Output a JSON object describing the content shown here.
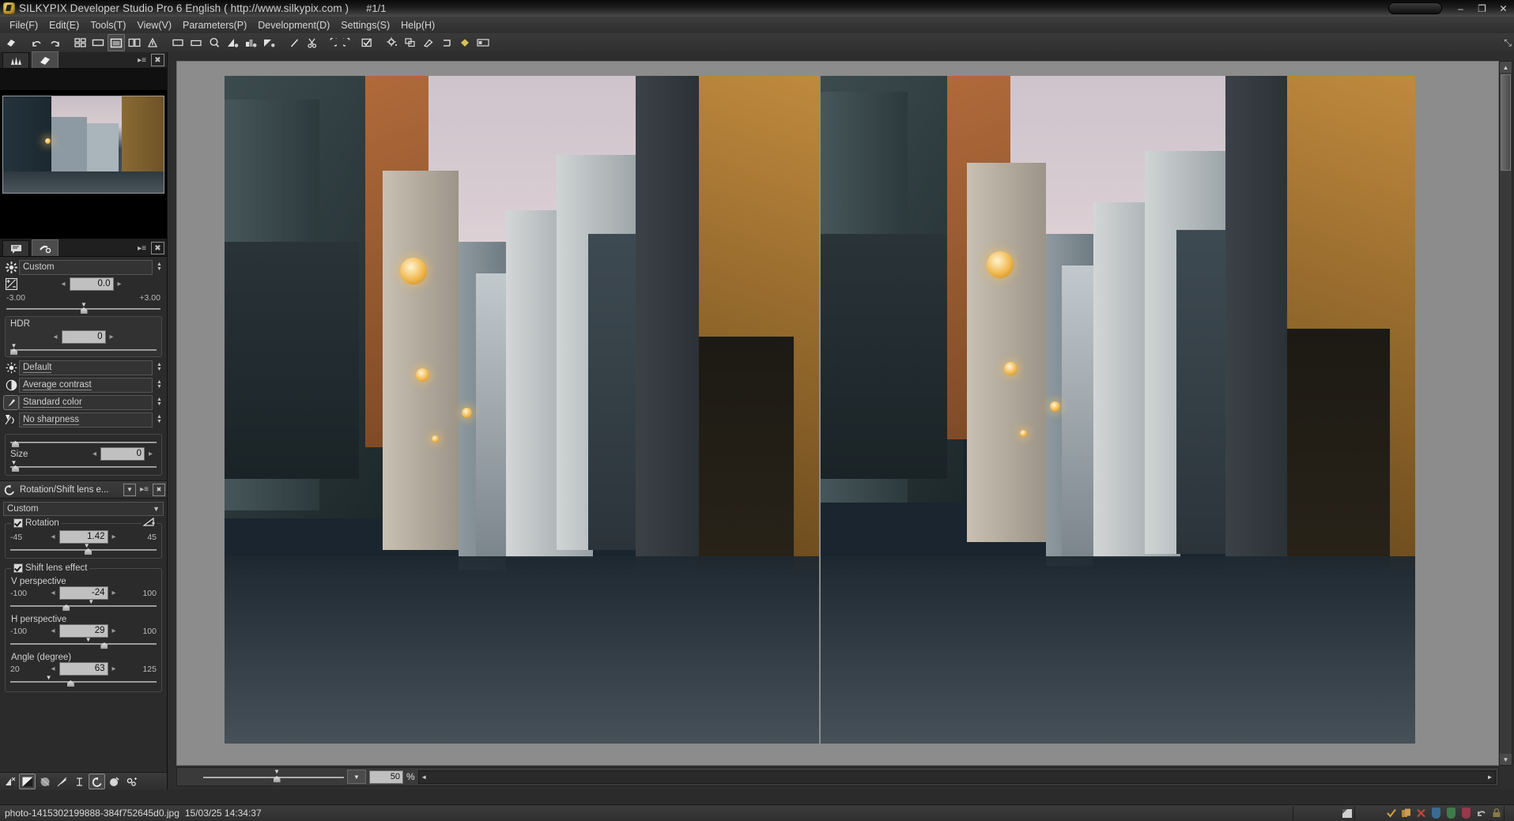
{
  "window": {
    "title": "SILKYPIX Developer Studio Pro 6 English ( http://www.silkypix.com )",
    "image_counter": "#1/1",
    "minimize": "–",
    "maximize": "❐",
    "close": "✕"
  },
  "menu": [
    {
      "label": "File(F)",
      "name": "menu-file"
    },
    {
      "label": "Edit(E)",
      "name": "menu-edit"
    },
    {
      "label": "Tools(T)",
      "name": "menu-tools"
    },
    {
      "label": "View(V)",
      "name": "menu-view"
    },
    {
      "label": "Parameters(P)",
      "name": "menu-parameters"
    },
    {
      "label": "Development(D)",
      "name": "menu-development"
    },
    {
      "label": "Settings(S)",
      "name": "menu-settings"
    },
    {
      "label": "Help(H)",
      "name": "menu-help"
    }
  ],
  "toolbar": {
    "icons": [
      "thumbnail-grid-icon",
      "undo-icon",
      "redo-icon",
      "grid-view-icon",
      "single-view-icon",
      "fit-view-icon",
      "compare-view-icon",
      "highlight-warning-icon",
      "full-screen-preview-icon",
      "preview-window-icon",
      "magnifier-icon",
      "exposure-tool-icon",
      "white-balance-tool-icon",
      "tone-tool-icon",
      "straighten-icon",
      "crop-icon",
      "rotate-left-icon",
      "rotate-right-icon",
      "taper-check-icon",
      "settings-gear-icon",
      "batch-icon",
      "spot-tool-icon",
      "rotation-shift-icon",
      "tag-icon",
      "layout-icon"
    ],
    "expand_label": "⤡"
  },
  "left_panel": {
    "top_tabs": [
      {
        "name": "tab-histogram",
        "icon": "histogram-icon",
        "active": false
      },
      {
        "name": "tab-preview-thumb",
        "icon": "thumbnail-icon",
        "active": true
      }
    ],
    "tab_menu_icon": "panel-menu-icon",
    "tab_close_icon": "panel-close-icon",
    "section_tabs": [
      {
        "name": "tab-comment",
        "icon": "comment-icon",
        "active": false
      },
      {
        "name": "tab-adjust",
        "icon": "adjust-tools-icon",
        "active": true
      }
    ],
    "taste": {
      "icon": "gear-icon",
      "value": "Custom"
    },
    "exposure": {
      "icon": "exposure-bias-icon",
      "value": "0.0",
      "min": "-3.00",
      "max": "+3.00",
      "knob_pct": 50,
      "marker_pct": 50
    },
    "hdr": {
      "label": "HDR",
      "value": "0",
      "knob_pct": 2,
      "marker_pct": 2
    },
    "selects": [
      {
        "name": "white-balance-select",
        "icon": "sun-icon",
        "value": "Default"
      },
      {
        "name": "contrast-select",
        "icon": "contrast-icon",
        "value": "Average contrast"
      },
      {
        "name": "color-select",
        "icon": "color-brush-icon",
        "value": "Standard color",
        "framed": true
      },
      {
        "name": "sharpness-select",
        "icon": "sharpness-icon",
        "value": "No sharpness"
      }
    ],
    "noise": {
      "upper_knob_pct": 2,
      "size_label": "Size",
      "size_value": "0",
      "lower_knob_pct": 2,
      "lower_marker_pct": 2
    },
    "rotation_section": {
      "icon": "rotation-reset-icon",
      "title": "Rotation/Shift lens e...",
      "dropdown_icon": "chevron-down-icon",
      "menu_icon": "section-menu-icon",
      "close_icon": "section-close-icon",
      "preset": "Custom",
      "rotation": {
        "label": "Rotation",
        "checked": true,
        "corner_icon": "angle-icon",
        "value": "1.42",
        "min": "-45",
        "max": "45",
        "knob_pct": 53,
        "marker_pct": 52
      },
      "shift_lens": {
        "label": "Shift lens effect",
        "checked": true,
        "fields": [
          {
            "name": "v-perspective",
            "label": "V perspective",
            "value": "-24",
            "min": "-100",
            "max": "100",
            "knob_pct": 38,
            "marker_pct": 55
          },
          {
            "name": "h-perspective",
            "label": "H perspective",
            "value": "29",
            "min": "-100",
            "max": "100",
            "knob_pct": 64,
            "marker_pct": 53
          },
          {
            "name": "angle-degree",
            "label": "Angle (degree)",
            "value": "63",
            "min": "20",
            "max": "125",
            "knob_pct": 41,
            "marker_pct": 26
          }
        ]
      }
    },
    "footer_icons": [
      {
        "name": "exposure-panel-icon",
        "active": false
      },
      {
        "name": "tone-curve-panel-icon",
        "active": true
      },
      {
        "name": "color-panel-icon",
        "active": false
      },
      {
        "name": "sharpness-panel-icon",
        "active": false
      },
      {
        "name": "lens-aberration-panel-icon",
        "active": false
      },
      {
        "name": "rotation-panel-icon",
        "active": true
      },
      {
        "name": "dodge-burn-panel-icon",
        "active": false
      },
      {
        "name": "settings-panel-icon",
        "active": false
      }
    ]
  },
  "viewer": {
    "zoom_value": "50",
    "zoom_unit": "%",
    "zoom_slider_pct": 52,
    "zoom_marker_pct": 52,
    "zoom_combo_icon": "chevron-down-icon",
    "scroll_left_icon": "◄",
    "scroll_right_icon": "►",
    "vscroll_up_icon": "▲",
    "vscroll_down_icon": "▼"
  },
  "statusbar": {
    "filename": "photo-1415302199888-384f752645d0.jpg",
    "datetime": "15/03/25 14:34:37",
    "icons": [
      {
        "name": "rating-flag-icon",
        "glyph": "◥",
        "color": "#d8d8d8"
      },
      {
        "name": "accept-check-icon",
        "glyph": "✓",
        "color": "#c8a33c"
      },
      {
        "name": "copy-icon",
        "glyph": "❐",
        "color": "#b5873c"
      },
      {
        "name": "reject-cross-icon",
        "glyph": "✕",
        "color": "#c8443c"
      },
      {
        "name": "blue-tag-icon",
        "glyph": "",
        "color": "#3a6a93"
      },
      {
        "name": "green-tag-icon",
        "glyph": "",
        "color": "#3f7a4a"
      },
      {
        "name": "red-tag-icon",
        "glyph": "",
        "color": "#96394a"
      },
      {
        "name": "undo-tag-icon",
        "glyph": "↶",
        "color": "#b9b9b9"
      },
      {
        "name": "lock-icon",
        "glyph": "ὑ2",
        "color": "#8a7a45"
      }
    ]
  },
  "colors": {
    "window_bg": "#2b2b2b",
    "canvas_bg": "#8c8c8c",
    "field_bg": "#c0c0c0",
    "accent_text": "#d5d5d5"
  }
}
